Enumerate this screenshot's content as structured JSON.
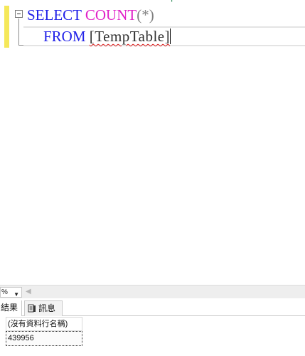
{
  "editor": {
    "top_clipped_text": "p",
    "line1": {
      "keyword": "SELECT",
      "function": "COUNT",
      "args": "(*)"
    },
    "line2": {
      "keyword": "FROM",
      "table": "[TempTable]"
    }
  },
  "zoom": {
    "value": "%"
  },
  "tabs": {
    "results_label": "結果",
    "messages_label": "訊息"
  },
  "results": {
    "column_header": "(沒有資料行名稱)",
    "rows": [
      {
        "value": "439956"
      }
    ]
  },
  "colors": {
    "keyword": "#2121e8",
    "function": "#e020c8",
    "operator": "#808080",
    "change_bar": "#f5e85a",
    "squiggle": "#e02020"
  },
  "icons": {
    "collapse": "collapse-minus-icon",
    "messages": "messages-icon",
    "zoom_dropdown": "chevron-down-icon",
    "scroll_left": "scroll-left-arrow-icon"
  }
}
